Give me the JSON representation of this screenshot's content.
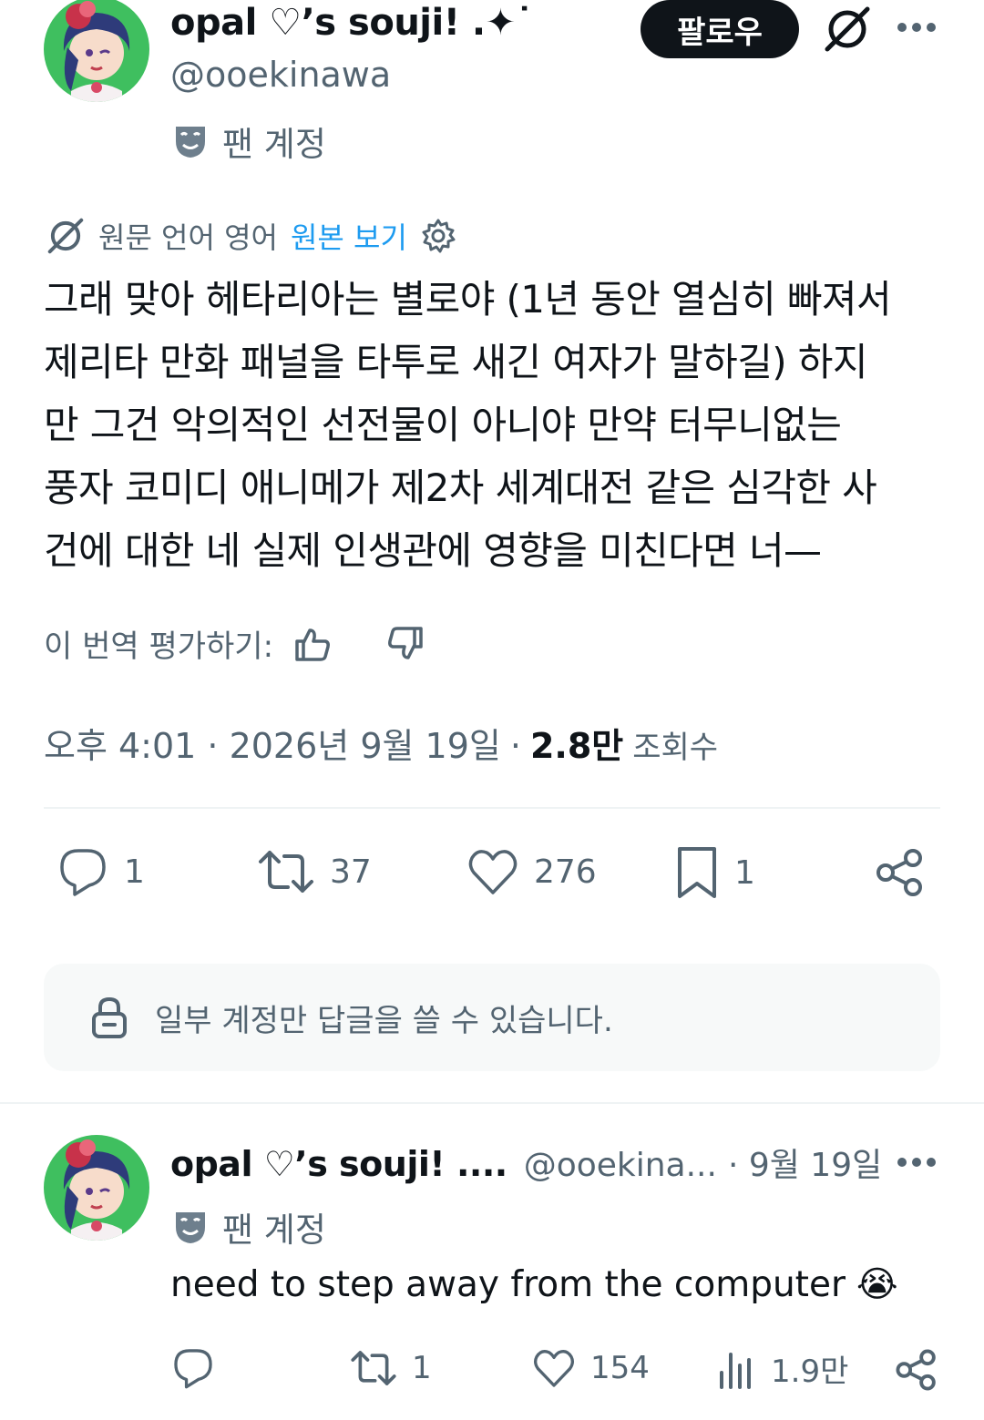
{
  "post": {
    "author_name": "opal ♡’s souji! .✦˙",
    "author_handle": "@ooekinawa",
    "follow_label": "팔로우",
    "fan_label": "팬 계정",
    "translation_info": "원문 언어 영어",
    "view_original": "원본 보기",
    "lines": [
      "그래 맞아 헤타리아는 별로야 (1년 동안 열심히 빠져서",
      "제리타 만화 패널을 타투로 새긴 여자가 말하길) 하지",
      "만 그건 악의적인 선전물이 아니야 만약 터무니없는",
      "풍자 코미디 애니메가 제2차 세계대전 같은 심각한 사",
      "건에 대한 네 실제 인생관에 영향을 미친다면 너—"
    ],
    "rate_label": "이 번역 평가하기:",
    "timestamp": "오후 4:01 · 2026년 9월 19일",
    "views_count": "2.8만",
    "views_label": "조회수",
    "actions": {
      "replies": "1",
      "reposts": "37",
      "likes": "276",
      "bookmarks": "1"
    },
    "reply_notice": "일부 계정만 답글을 쓸 수 있습니다."
  },
  "reply": {
    "author_name": "opal ♡’s souji! ....",
    "author_handle": "@ooekina...",
    "date": "· 9월 19일",
    "fan_label": "팬 계정",
    "text": "need to step away from the computer",
    "emoji": "😭",
    "actions": {
      "replies": "",
      "reposts": "1",
      "likes": "154",
      "views": "1.9만"
    }
  },
  "icons": {
    "more": "more-icon",
    "grok": "grok-icon",
    "fan": "theater-mask-icon",
    "settings": "gear-icon",
    "thumbs_up": "thumbs-up-icon",
    "thumbs_down": "thumbs-down-icon",
    "reply": "reply-icon",
    "repost": "repost-icon",
    "like": "heart-icon",
    "bookmark": "bookmark-icon",
    "share": "share-icon",
    "lock": "lock-icon",
    "views": "bar-chart-icon"
  },
  "colors": {
    "text": "#0f1419",
    "muted": "#536471",
    "link": "#1d9bf0",
    "button": "#0f1419",
    "divider": "#eff3f4",
    "notice_bg": "#f7f9f9"
  }
}
